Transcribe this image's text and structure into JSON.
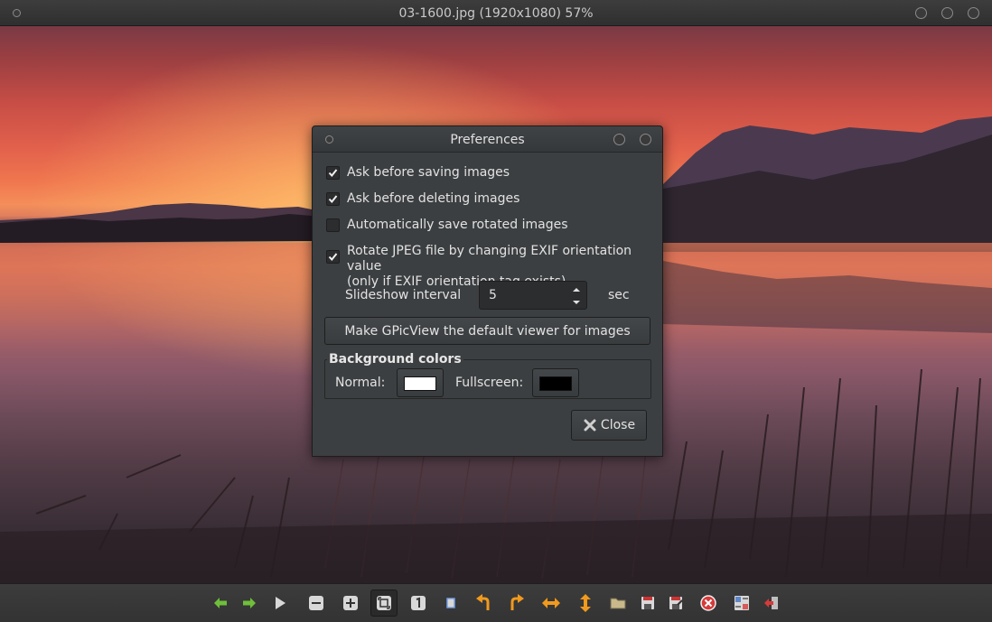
{
  "window": {
    "title": "03-1600.jpg (1920x1080) 57%"
  },
  "dialog": {
    "title": "Preferences",
    "options": [
      {
        "label": "Ask before saving images",
        "checked": true
      },
      {
        "label": "Ask before deleting images",
        "checked": true
      },
      {
        "label": "Automatically save rotated images",
        "checked": false
      },
      {
        "label": "Rotate JPEG file by changing EXIF orientation value",
        "label2": "(only if EXIF orientation tag exists)",
        "checked": true
      }
    ],
    "slideshow": {
      "label": "Slideshow interval",
      "value": "5",
      "unit": "sec"
    },
    "default_viewer_button": "Make GPicView the default viewer for images",
    "background_colors": {
      "legend": "Background colors",
      "normal_label": "Normal:",
      "normal_color": "#ffffff",
      "fullscreen_label": "Fullscreen:",
      "fullscreen_color": "#000000"
    },
    "close_button": "Close"
  },
  "toolbar": {
    "buttons": [
      {
        "name": "prev-icon",
        "color": "#6fbf3a"
      },
      {
        "name": "next-icon",
        "color": "#6fbf3a"
      },
      {
        "name": "slideshow-play-icon",
        "color": "#d8d8d8"
      },
      {
        "name": "zoom-out-icon",
        "color": "#d8d8d8"
      },
      {
        "name": "zoom-in-icon",
        "color": "#d8d8d8"
      },
      {
        "name": "zoom-fit-icon",
        "color": "#d8d8d8"
      },
      {
        "name": "zoom-original-icon",
        "color": "#d8d8d8"
      },
      {
        "name": "fullscreen-icon",
        "color": "#d8d8d8"
      },
      {
        "name": "rotate-left-icon",
        "color": "#f09a1e"
      },
      {
        "name": "rotate-right-icon",
        "color": "#f09a1e"
      },
      {
        "name": "flip-horizontal-icon",
        "color": "#f09a1e"
      },
      {
        "name": "flip-vertical-icon",
        "color": "#f09a1e"
      },
      {
        "name": "open-file-icon",
        "color": "#c9b98a"
      },
      {
        "name": "save-icon",
        "color": "#d8d8d8"
      },
      {
        "name": "save-as-icon",
        "color": "#d8d8d8"
      },
      {
        "name": "delete-icon",
        "color": "#d63a3a"
      },
      {
        "name": "preferences-icon",
        "color": "#d8d8d8"
      },
      {
        "name": "quit-icon",
        "color": "#d63a3a"
      }
    ]
  }
}
